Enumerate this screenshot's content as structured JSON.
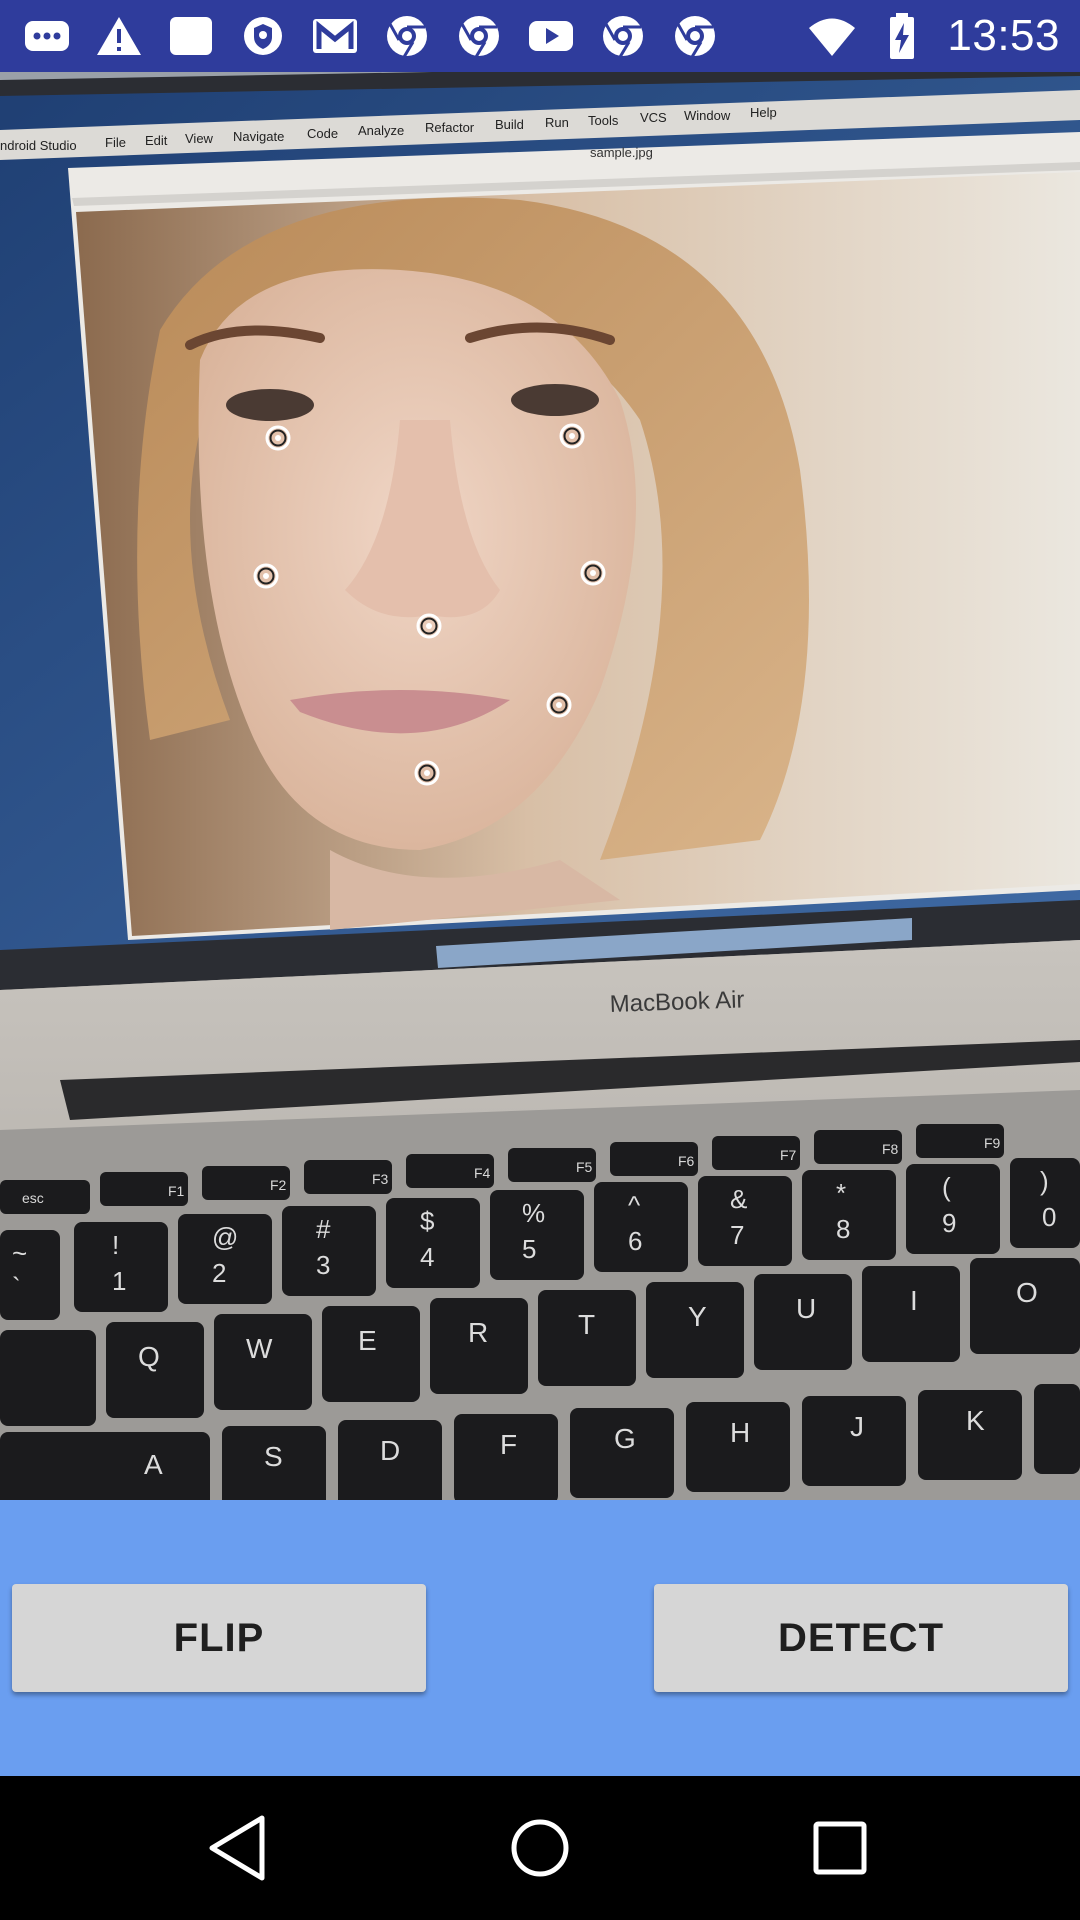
{
  "status_bar": {
    "time": "13:53",
    "icons": [
      "messaging-icon",
      "warning-icon",
      "blank-card-icon",
      "vpn-shield-icon",
      "gmail-icon",
      "chrome-icon",
      "chrome-icon",
      "youtube-icon",
      "chrome-icon",
      "chrome-icon",
      "wifi-icon",
      "battery-charging-icon"
    ]
  },
  "camera_preview": {
    "scene_text": {
      "menu_items": [
        "ndroid Studio",
        "File",
        "Edit",
        "View",
        "Navigate",
        "Code",
        "Analyze",
        "Refactor",
        "Build",
        "Run",
        "Tools",
        "VCS",
        "Window",
        "Help"
      ],
      "file_name": "sample.jpg",
      "laptop_brand": "MacBook Air",
      "key_row_fn": [
        "esc",
        "F1",
        "F2",
        "F3",
        "F4",
        "F5",
        "F6",
        "F7",
        "F8",
        "F9"
      ],
      "key_row_num": [
        "~",
        "!",
        "@",
        "#",
        "$",
        "%",
        "^",
        "&",
        "*",
        "(",
        ")"
      ],
      "key_row_num_bottom": [
        "`",
        "1",
        "2",
        "3",
        "4",
        "5",
        "6",
        "7",
        "8",
        "9",
        "0"
      ],
      "key_row_q": [
        "Q",
        "W",
        "E",
        "R",
        "T",
        "Y",
        "U",
        "I",
        "O"
      ],
      "key_row_a": [
        "A",
        "S",
        "D",
        "F",
        "G",
        "H",
        "J",
        "K"
      ]
    },
    "face_landmarks": [
      {
        "name": "left-eye"
      },
      {
        "name": "right-eye"
      },
      {
        "name": "left-cheek"
      },
      {
        "name": "right-cheek"
      },
      {
        "name": "nose-base"
      },
      {
        "name": "mouth-right"
      },
      {
        "name": "chin"
      }
    ]
  },
  "controls": {
    "flip_label": "FLIP",
    "detect_label": "DETECT",
    "background_color": "#6a9ef0"
  },
  "nav_bar": {
    "icons": [
      "back-icon",
      "home-icon",
      "recents-icon"
    ]
  }
}
